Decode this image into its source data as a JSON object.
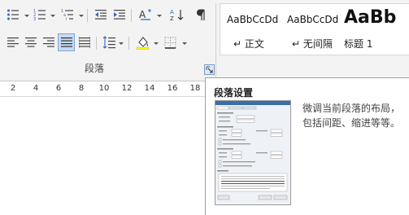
{
  "paragraph_group": {
    "label": "段落",
    "tools": {
      "bullets": "bullets-icon",
      "numbering": "numbering-icon",
      "multilevel_list": "multilevel-list-icon",
      "decrease_indent": "decrease-indent-icon",
      "increase_indent": "increase-indent-icon",
      "chinese_layout": "chinese-layout-icon",
      "sort": "sort-icon",
      "show_marks": "pilcrow-icon",
      "align_left": "align-left-icon",
      "center": "center-icon",
      "align_right": "align-right-icon",
      "justify": "justify-icon",
      "distributed": "distributed-icon",
      "line_spacing": "line-spacing-icon",
      "shading": "shading-icon",
      "borders": "borders-icon"
    },
    "active_tool": "justify",
    "launcher_icon": "dialog-launcher-icon"
  },
  "styles_gallery": {
    "items": [
      {
        "preview": "AaBbCcDd",
        "name": "↵ 正文"
      },
      {
        "preview": "AaBbCcDd",
        "name": "↵ 无间隔"
      },
      {
        "preview": "AaBb",
        "name": "标题 1"
      }
    ]
  },
  "ruler": {
    "ticks": [
      "2",
      "4",
      "6",
      "8",
      "10",
      "12",
      "14",
      "16",
      "18"
    ]
  },
  "tooltip": {
    "title": "段落设置",
    "description": "微调当前段落的布局，包括间距、缩进等等。",
    "thumbnail": "paragraph-dialog-preview"
  },
  "colors": {
    "ribbon_bg": "#f3f3f3",
    "active_button_bg": "#c5daf1",
    "active_button_border": "#7ea6d6",
    "icon_blue": "#2b6cc0"
  }
}
